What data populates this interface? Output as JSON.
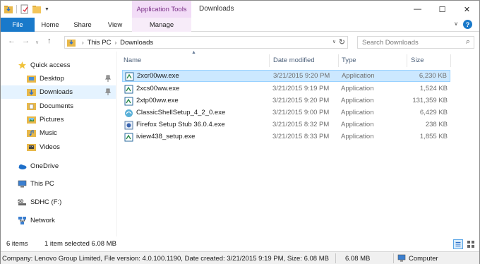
{
  "titlebar": {
    "app_tools_label": "Application Tools",
    "window_title": "Downloads",
    "minimize": "—",
    "maximize": "☐",
    "close": "✕"
  },
  "ribbon": {
    "tabs": [
      "File",
      "Home",
      "Share",
      "View",
      "Manage"
    ]
  },
  "address": {
    "root": "This PC",
    "current": "Downloads",
    "search_placeholder": "Search Downloads"
  },
  "nav": {
    "quick_access": "Quick access",
    "items": [
      {
        "label": "Desktop",
        "icon": "desktop-folder-icon",
        "pinned": true
      },
      {
        "label": "Downloads",
        "icon": "downloads-folder-icon",
        "pinned": true,
        "selected": true
      },
      {
        "label": "Documents",
        "icon": "documents-folder-icon"
      },
      {
        "label": "Pictures",
        "icon": "pictures-folder-icon"
      },
      {
        "label": "Music",
        "icon": "music-folder-icon"
      },
      {
        "label": "Videos",
        "icon": "videos-folder-icon"
      }
    ],
    "onedrive": "OneDrive",
    "this_pc": "This PC",
    "sdhc": "SDHC (F:)",
    "network": "Network"
  },
  "columns": {
    "name": "Name",
    "date": "Date modified",
    "type": "Type",
    "size": "Size"
  },
  "files": [
    {
      "name": "2xcr00ww.exe",
      "date": "3/21/2015 9:20 PM",
      "type": "Application",
      "size": "6,230 KB",
      "selected": true
    },
    {
      "name": "2xcs00ww.exe",
      "date": "3/21/2015 9:19 PM",
      "type": "Application",
      "size": "1,524 KB"
    },
    {
      "name": "2xtp00ww.exe",
      "date": "3/21/2015 9:20 PM",
      "type": "Application",
      "size": "131,359 KB"
    },
    {
      "name": "ClassicShellSetup_4_2_0.exe",
      "date": "3/21/2015 9:00 PM",
      "type": "Application",
      "size": "6,429 KB"
    },
    {
      "name": "Firefox Setup Stub 36.0.4.exe",
      "date": "3/21/2015 8:32 PM",
      "type": "Application",
      "size": "238 KB"
    },
    {
      "name": "iview438_setup.exe",
      "date": "3/21/2015 8:33 PM",
      "type": "Application",
      "size": "1,855 KB"
    }
  ],
  "status": {
    "items_count": "6 items",
    "selected": "1 item selected  6.08 MB"
  },
  "details": {
    "info": "Company: Lenovo Group Limited, File version: 4.0.100.1190, Date created: 3/21/2015 9:19 PM, Size: 6.08 MB",
    "size": "6.08 MB",
    "location": "Computer"
  },
  "colors": {
    "accent": "#1979ca",
    "selection": "#cce8ff",
    "app_tools_bg": "#f2dcf7"
  }
}
